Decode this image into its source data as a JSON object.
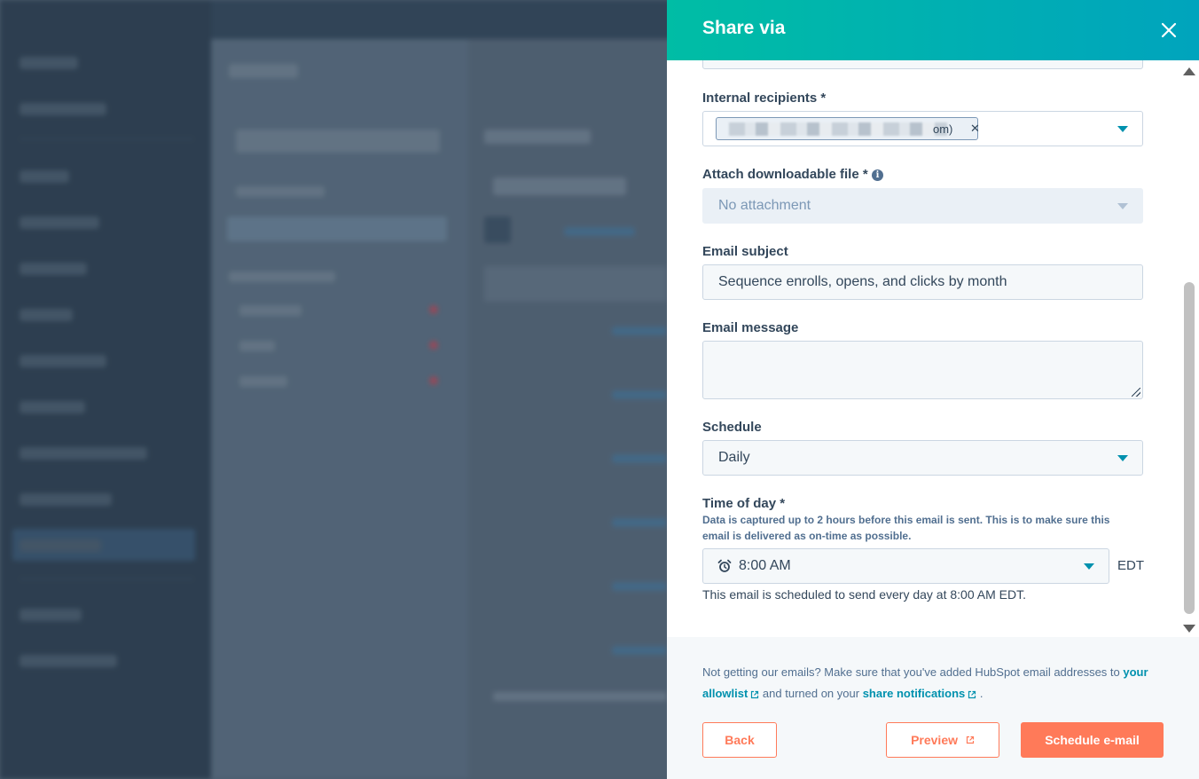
{
  "modal": {
    "title": "Share via",
    "fields": {
      "internal_recipients": {
        "label": "Internal recipients *",
        "chip_visible_text": "om)"
      },
      "attachment": {
        "label": "Attach downloadable file *",
        "value": "No attachment"
      },
      "email_subject": {
        "label": "Email subject",
        "value": "Sequence enrolls, opens, and clicks by month"
      },
      "email_message": {
        "label": "Email message",
        "value": ""
      },
      "schedule": {
        "label": "Schedule",
        "value": "Daily"
      },
      "time_of_day": {
        "label": "Time of day *",
        "help": "Data is captured up to 2 hours before this email is sent. This is to make sure this email is delivered as on-time as possible.",
        "value": "8:00 AM",
        "timezone": "EDT",
        "summary": "This email is scheduled to send every day at 8:00 AM EDT."
      }
    },
    "footer": {
      "note_prefix": "Not getting our emails? Make sure that you've added HubSpot email addresses to",
      "allowlist_link": "your allowlist",
      "note_middle": "and turned on your",
      "share_link": "share notifications",
      "note_suffix": ".",
      "back_label": "Back",
      "preview_label": "Preview",
      "schedule_label": "Schedule e-mail"
    },
    "colors": {
      "header_gradient_start": "#00bda5",
      "header_gradient_end": "#00a4bd",
      "accent": "#ff7a59",
      "link": "#0091ae"
    }
  }
}
